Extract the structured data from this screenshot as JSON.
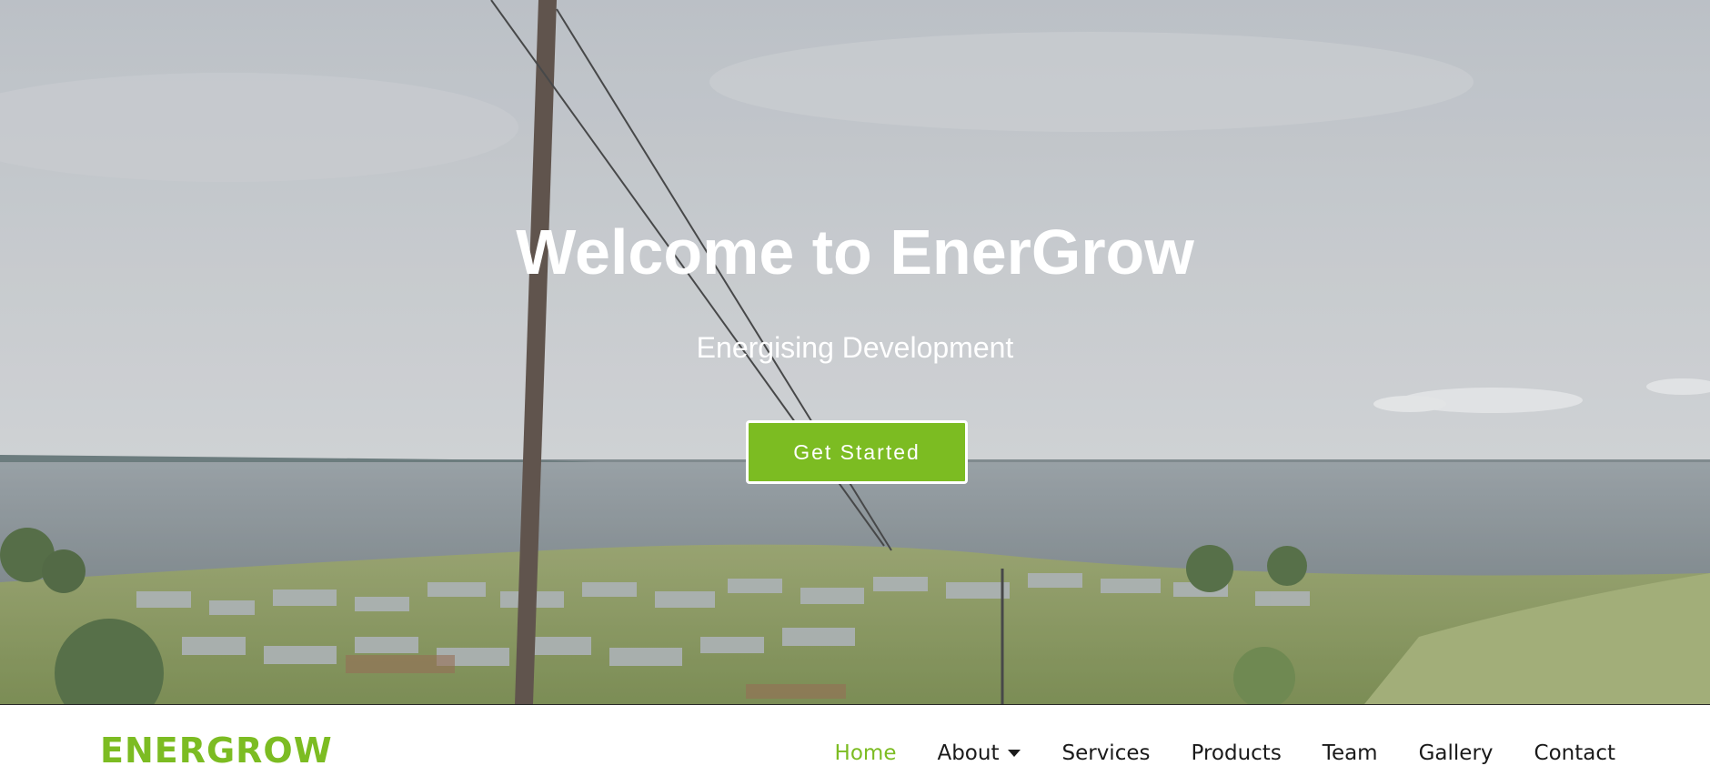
{
  "hero": {
    "title": "Welcome to EnerGrow",
    "subtitle": "Energising Development",
    "cta_label": "Get Started"
  },
  "navbar": {
    "logo": "ENERGROW",
    "items": [
      {
        "label": "Home",
        "active": true
      },
      {
        "label": "About",
        "has_dropdown": true
      },
      {
        "label": "Services"
      },
      {
        "label": "Products"
      },
      {
        "label": "Team"
      },
      {
        "label": "Gallery"
      },
      {
        "label": "Contact"
      }
    ]
  },
  "colors": {
    "brand_green": "#7cbc22",
    "nav_text": "#1a1a1a",
    "hero_text": "#ffffff"
  }
}
